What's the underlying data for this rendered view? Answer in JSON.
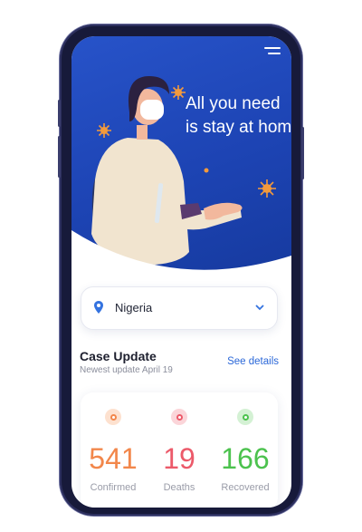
{
  "hero": {
    "headline": "All you need\nis stay at hom"
  },
  "location": {
    "country": "Nigeria"
  },
  "case_update": {
    "title": "Case Update",
    "subtitle": "Newest update April 19",
    "link": "See details"
  },
  "stats": [
    {
      "value": "541",
      "label": "Confirmed",
      "color": "#f2874b",
      "ring": "#fde1cf"
    },
    {
      "value": "19",
      "label": "Deaths",
      "color": "#ec5a6a",
      "ring": "#fbd5d9"
    },
    {
      "value": "166",
      "label": "Recovered",
      "color": "#4cc24e",
      "ring": "#d4f1d4"
    }
  ],
  "colors": {
    "hero_blue": "#2050c4",
    "accent_link": "#2a67d8"
  }
}
